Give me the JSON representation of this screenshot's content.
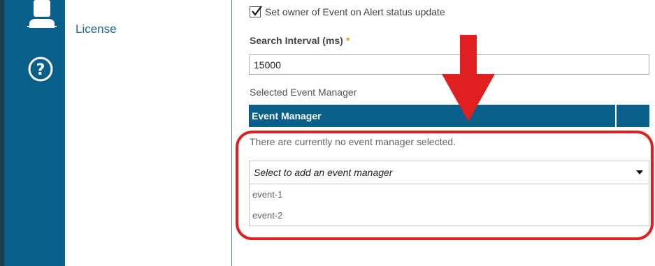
{
  "sidebar": {
    "items": [
      {
        "label": "License",
        "icon": "user-icon"
      },
      {
        "icon": "help-icon"
      }
    ]
  },
  "settings": {
    "checkbox_label": "Set owner of Event on Alert status update",
    "checkbox_checked": true,
    "search_interval_label": "Search Interval (ms)",
    "required_marker": "*",
    "search_interval_value": "15000",
    "selected_event_manager_label": "Selected Event Manager",
    "table_header": "Event Manager",
    "empty_message": "There are currently no event manager selected.",
    "dropdown": {
      "placeholder": "Select to add an event manager",
      "options": [
        "event-1",
        "event-2"
      ]
    }
  },
  "annotation": {
    "color": "#e02020"
  },
  "colors": {
    "sidebar": "#075f8a",
    "header": "#075f8a",
    "link": "#1f6a93"
  }
}
